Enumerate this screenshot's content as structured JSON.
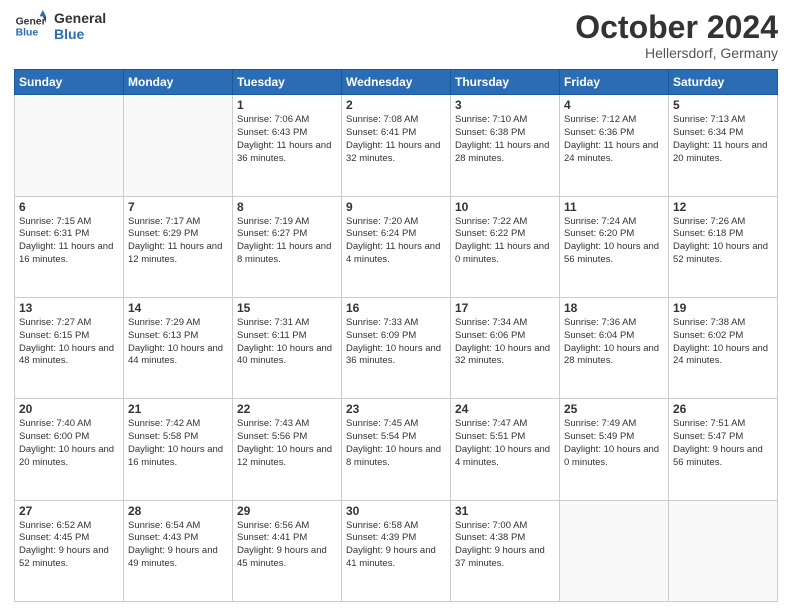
{
  "logo": {
    "line1": "General",
    "line2": "Blue"
  },
  "title": "October 2024",
  "location": "Hellersdorf, Germany",
  "weekdays": [
    "Sunday",
    "Monday",
    "Tuesday",
    "Wednesday",
    "Thursday",
    "Friday",
    "Saturday"
  ],
  "weeks": [
    [
      {
        "day": "",
        "info": ""
      },
      {
        "day": "",
        "info": ""
      },
      {
        "day": "1",
        "info": "Sunrise: 7:06 AM\nSunset: 6:43 PM\nDaylight: 11 hours\nand 36 minutes."
      },
      {
        "day": "2",
        "info": "Sunrise: 7:08 AM\nSunset: 6:41 PM\nDaylight: 11 hours\nand 32 minutes."
      },
      {
        "day": "3",
        "info": "Sunrise: 7:10 AM\nSunset: 6:38 PM\nDaylight: 11 hours\nand 28 minutes."
      },
      {
        "day": "4",
        "info": "Sunrise: 7:12 AM\nSunset: 6:36 PM\nDaylight: 11 hours\nand 24 minutes."
      },
      {
        "day": "5",
        "info": "Sunrise: 7:13 AM\nSunset: 6:34 PM\nDaylight: 11 hours\nand 20 minutes."
      }
    ],
    [
      {
        "day": "6",
        "info": "Sunrise: 7:15 AM\nSunset: 6:31 PM\nDaylight: 11 hours\nand 16 minutes."
      },
      {
        "day": "7",
        "info": "Sunrise: 7:17 AM\nSunset: 6:29 PM\nDaylight: 11 hours\nand 12 minutes."
      },
      {
        "day": "8",
        "info": "Sunrise: 7:19 AM\nSunset: 6:27 PM\nDaylight: 11 hours\nand 8 minutes."
      },
      {
        "day": "9",
        "info": "Sunrise: 7:20 AM\nSunset: 6:24 PM\nDaylight: 11 hours\nand 4 minutes."
      },
      {
        "day": "10",
        "info": "Sunrise: 7:22 AM\nSunset: 6:22 PM\nDaylight: 11 hours\nand 0 minutes."
      },
      {
        "day": "11",
        "info": "Sunrise: 7:24 AM\nSunset: 6:20 PM\nDaylight: 10 hours\nand 56 minutes."
      },
      {
        "day": "12",
        "info": "Sunrise: 7:26 AM\nSunset: 6:18 PM\nDaylight: 10 hours\nand 52 minutes."
      }
    ],
    [
      {
        "day": "13",
        "info": "Sunrise: 7:27 AM\nSunset: 6:15 PM\nDaylight: 10 hours\nand 48 minutes."
      },
      {
        "day": "14",
        "info": "Sunrise: 7:29 AM\nSunset: 6:13 PM\nDaylight: 10 hours\nand 44 minutes."
      },
      {
        "day": "15",
        "info": "Sunrise: 7:31 AM\nSunset: 6:11 PM\nDaylight: 10 hours\nand 40 minutes."
      },
      {
        "day": "16",
        "info": "Sunrise: 7:33 AM\nSunset: 6:09 PM\nDaylight: 10 hours\nand 36 minutes."
      },
      {
        "day": "17",
        "info": "Sunrise: 7:34 AM\nSunset: 6:06 PM\nDaylight: 10 hours\nand 32 minutes."
      },
      {
        "day": "18",
        "info": "Sunrise: 7:36 AM\nSunset: 6:04 PM\nDaylight: 10 hours\nand 28 minutes."
      },
      {
        "day": "19",
        "info": "Sunrise: 7:38 AM\nSunset: 6:02 PM\nDaylight: 10 hours\nand 24 minutes."
      }
    ],
    [
      {
        "day": "20",
        "info": "Sunrise: 7:40 AM\nSunset: 6:00 PM\nDaylight: 10 hours\nand 20 minutes."
      },
      {
        "day": "21",
        "info": "Sunrise: 7:42 AM\nSunset: 5:58 PM\nDaylight: 10 hours\nand 16 minutes."
      },
      {
        "day": "22",
        "info": "Sunrise: 7:43 AM\nSunset: 5:56 PM\nDaylight: 10 hours\nand 12 minutes."
      },
      {
        "day": "23",
        "info": "Sunrise: 7:45 AM\nSunset: 5:54 PM\nDaylight: 10 hours\nand 8 minutes."
      },
      {
        "day": "24",
        "info": "Sunrise: 7:47 AM\nSunset: 5:51 PM\nDaylight: 10 hours\nand 4 minutes."
      },
      {
        "day": "25",
        "info": "Sunrise: 7:49 AM\nSunset: 5:49 PM\nDaylight: 10 hours\nand 0 minutes."
      },
      {
        "day": "26",
        "info": "Sunrise: 7:51 AM\nSunset: 5:47 PM\nDaylight: 9 hours\nand 56 minutes."
      }
    ],
    [
      {
        "day": "27",
        "info": "Sunrise: 6:52 AM\nSunset: 4:45 PM\nDaylight: 9 hours\nand 52 minutes."
      },
      {
        "day": "28",
        "info": "Sunrise: 6:54 AM\nSunset: 4:43 PM\nDaylight: 9 hours\nand 49 minutes."
      },
      {
        "day": "29",
        "info": "Sunrise: 6:56 AM\nSunset: 4:41 PM\nDaylight: 9 hours\nand 45 minutes."
      },
      {
        "day": "30",
        "info": "Sunrise: 6:58 AM\nSunset: 4:39 PM\nDaylight: 9 hours\nand 41 minutes."
      },
      {
        "day": "31",
        "info": "Sunrise: 7:00 AM\nSunset: 4:38 PM\nDaylight: 9 hours\nand 37 minutes."
      },
      {
        "day": "",
        "info": ""
      },
      {
        "day": "",
        "info": ""
      }
    ]
  ]
}
